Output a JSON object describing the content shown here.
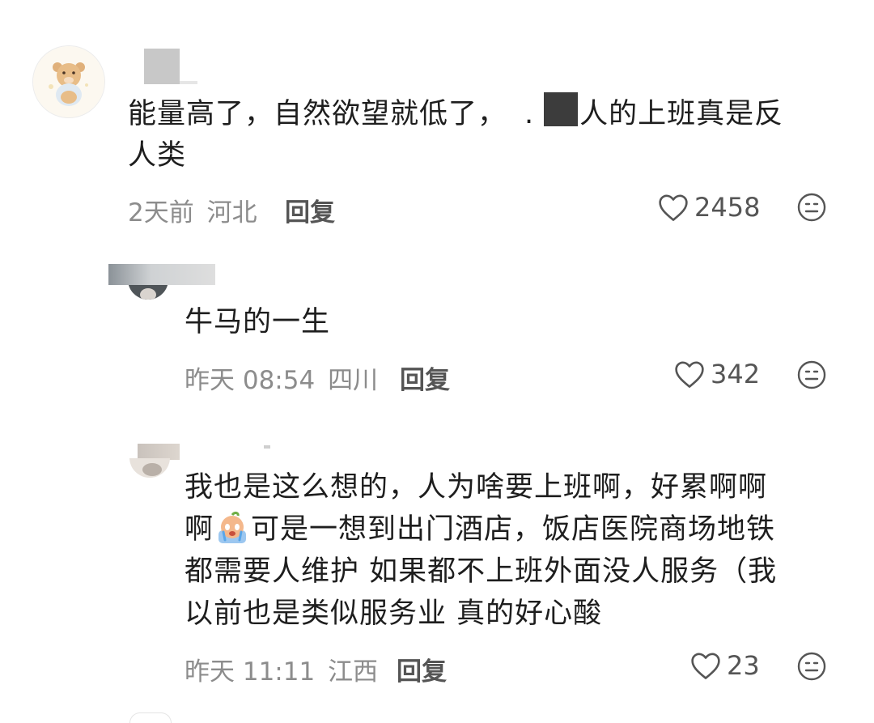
{
  "comments": [
    {
      "text_line1_a": "能量高了，自然欲望就低了，",
      "text_line1_b": ".",
      "text_line1_c": "人的上班真是反",
      "text_line2": "人类",
      "time": "2天前",
      "location": "河北",
      "reply_label": "回复",
      "likes": "2458"
    },
    {
      "text": "牛马的一生",
      "time": "昨天 08:54",
      "location": "四川",
      "reply_label": "回复",
      "likes": "342"
    },
    {
      "line1": "我也是这么想的，人为啥要上班啊，好累啊啊",
      "line2_a": "啊",
      "line2_b": "可是一想到出门酒店，饭店医院商场地铁",
      "line3": "都需要人维护 如果都不上班外面没人服务（我",
      "line4": "以前也是类似服务业 真的好心酸",
      "time": "昨天 11:11",
      "location": "江西",
      "reply_label": "回复",
      "likes": "23"
    }
  ],
  "icons": {
    "like": "heart-outline-icon",
    "more": "smiley-face-icon"
  }
}
